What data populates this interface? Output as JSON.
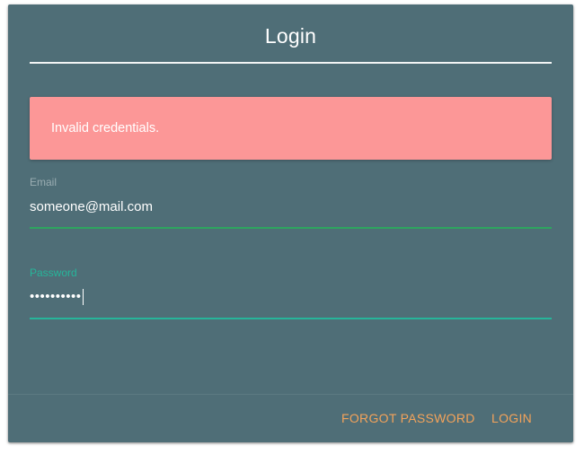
{
  "form": {
    "title": "Login",
    "alert": {
      "message": "Invalid credentials.",
      "color": "#fc9797"
    },
    "email": {
      "label": "Email",
      "value": "someone@mail.com"
    },
    "password": {
      "label": "Password",
      "value": "••••••••••"
    },
    "actions": {
      "forgot_label": "FORGOT PASSWORD",
      "login_label": "LOGIN"
    }
  },
  "colors": {
    "card_background": "#4f6e77",
    "accent_action": "#f4a35a",
    "focus_teal": "#26b59a",
    "email_underline": "#2ea55f"
  }
}
